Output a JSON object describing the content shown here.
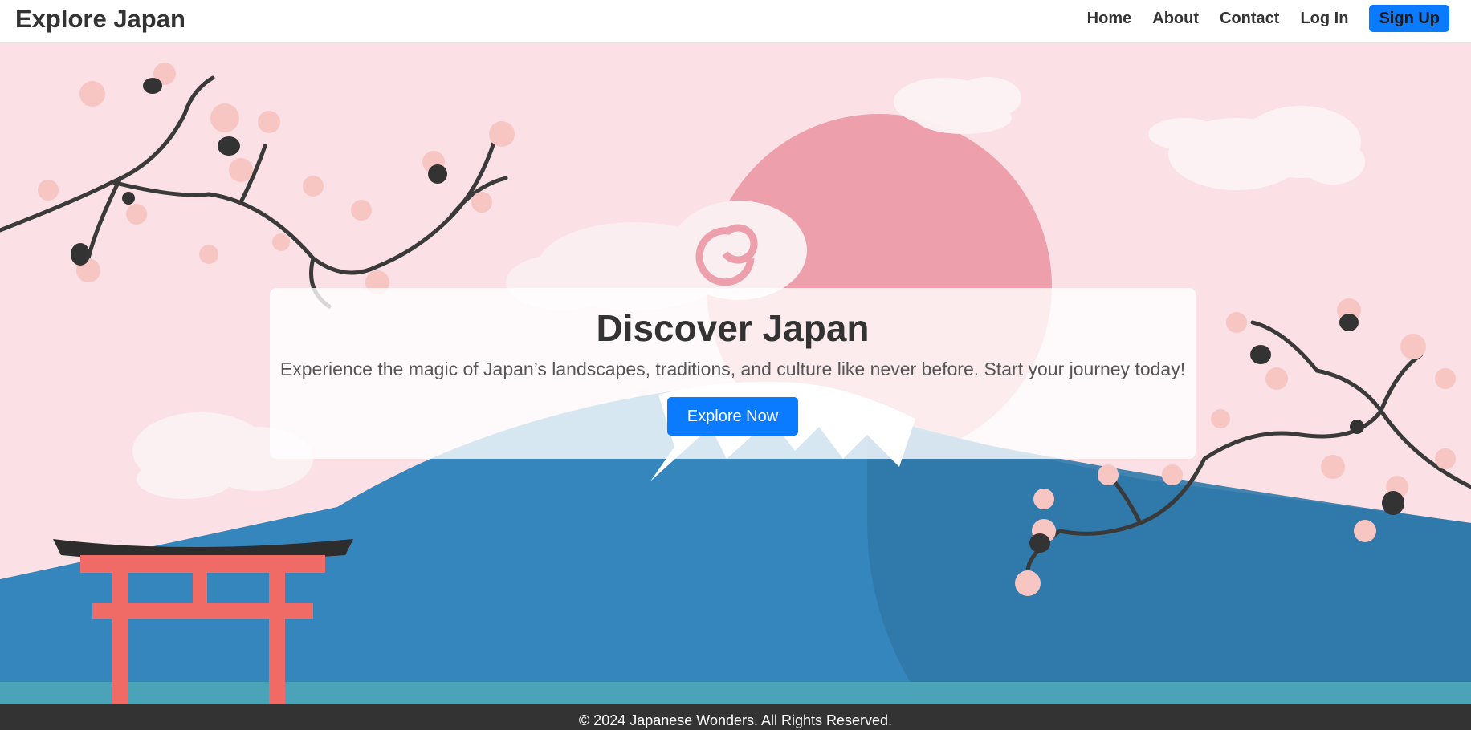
{
  "navbar": {
    "brand": "Explore Japan",
    "links": [
      {
        "label": "Home"
      },
      {
        "label": "About"
      },
      {
        "label": "Contact"
      },
      {
        "label": "Log In"
      }
    ],
    "signup_label": "Sign Up"
  },
  "hero": {
    "title": "Discover Japan",
    "text": "Experience the magic of Japan’s landscapes, traditions, and culture like never before. Start your journey today!",
    "button_label": "Explore Now",
    "illustration": [
      "sun-icon",
      "clouds",
      "mount-fuji",
      "cherry-blossom-branches",
      "torii-gate",
      "water"
    ]
  },
  "footer": {
    "text": "© 2024 Japanese Wonders. All Rights Reserved."
  },
  "colors": {
    "accent": "#0a7bff",
    "sky": "#fbe0e6",
    "sun": "#ee9fac",
    "mountain": "#3586bd",
    "torii": "#f06b66",
    "footer": "#333333"
  }
}
